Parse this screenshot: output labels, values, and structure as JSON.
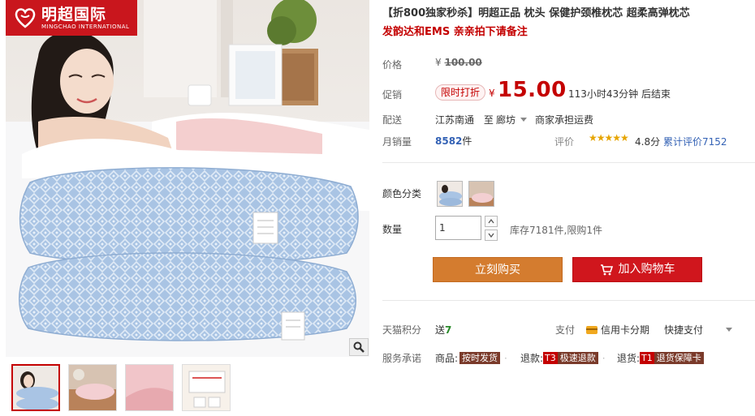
{
  "brand": {
    "name_cn": "明超国际",
    "name_en": "MINGCHAO INTERNATIONAL"
  },
  "product": {
    "title": "【折800独家秒杀】明超正品 枕头 保健护颈椎枕芯 超柔高弹枕芯",
    "subtitle": "发韵达和EMS 亲亲拍下请备注"
  },
  "price": {
    "label": "价格",
    "currency": "¥",
    "original": "100.00"
  },
  "promo": {
    "label": "促销",
    "badge": "限时打折",
    "currency": "¥",
    "price": "15.00",
    "countdown": "113小时43分钟 后结束"
  },
  "shipping": {
    "label": "配送",
    "from": "江苏南通",
    "to_word": "至",
    "to": "廊坊",
    "fee": "商家承担运费"
  },
  "sales": {
    "label": "月销量",
    "count": "8582",
    "unit": "件",
    "rating_label": "评价",
    "stars": "★★★★★",
    "score": "4.8分",
    "reviews": "累计评价7152"
  },
  "options": {
    "color_label": "颜色分类",
    "qty_label": "数量",
    "qty_value": "1",
    "stock": "库存7181件,限购1件"
  },
  "actions": {
    "buy_now": "立刻购买",
    "add_cart": "加入购物车"
  },
  "points": {
    "label": "天猫积分",
    "text": "送",
    "value": "7"
  },
  "payment": {
    "label": "支付",
    "credit": "信用卡分期",
    "quick": "快捷支付"
  },
  "services": {
    "label": "服务承诺",
    "goods_prefix": "商品:",
    "goods_tag": "按时发货",
    "refund_prefix": "退款:",
    "refund_badge": "T3",
    "refund_tag": "极速退款",
    "return_prefix": "退货:",
    "return_badge": "T1",
    "return_tag": "退货保障卡"
  },
  "colors": {
    "accent": "#c40000",
    "buy": "#d47c2f",
    "cart": "#d0161d",
    "brand": "#c9161d",
    "link": "#3462b5"
  }
}
